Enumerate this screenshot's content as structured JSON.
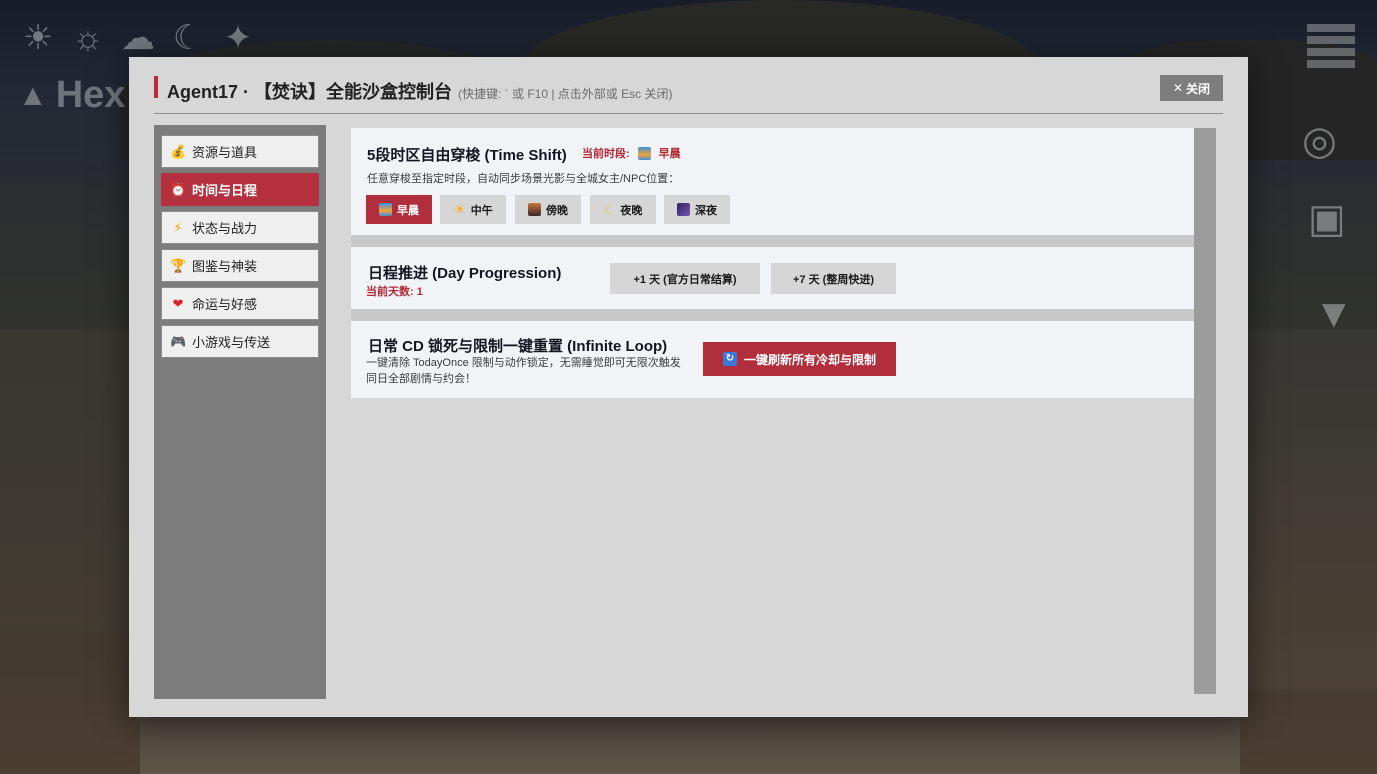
{
  "hud": {
    "title": "Hex",
    "left_icons": [
      "sunrise-icon",
      "sun-icon",
      "sunset-icon",
      "moon-icon",
      "star-icon"
    ]
  },
  "modal": {
    "title": "Agent17 · 【焚诀】全能沙盒控制台",
    "hint": "(快捷键: ` 或 F10 | 点击外部或 Esc 关闭)",
    "close_label": "关闭",
    "close_icon": "✕"
  },
  "sidebar": {
    "items": [
      {
        "label": "资源与道具",
        "icon": "💰",
        "icon_name": "money-bag-icon",
        "active": false
      },
      {
        "label": "时间与日程",
        "icon": "⏰",
        "icon_name": "alarm-clock-icon",
        "active": true
      },
      {
        "label": "状态与战力",
        "icon": "⚡",
        "icon_name": "lightning-icon",
        "active": false
      },
      {
        "label": "图鉴与神装",
        "icon": "🏆",
        "icon_name": "trophy-icon",
        "active": false
      },
      {
        "label": "命运与好感",
        "icon": "❤",
        "icon_name": "heart-icon",
        "active": false
      },
      {
        "label": "小游戏与传送",
        "icon": "🎮",
        "icon_name": "gamepad-icon",
        "active": false
      }
    ]
  },
  "time_shift": {
    "title": "5段时区自由穿梭 (Time Shift)",
    "current_label": "当前时段:",
    "current_value": "早晨",
    "description": "任意穿梭至指定时段，自动同步场景光影与全城女主/NPC位置：",
    "buttons": [
      {
        "label": "早晨",
        "icon_name": "sunrise-icon",
        "active": true,
        "icon_color": "#f0a43a"
      },
      {
        "label": "中午",
        "icon_name": "sun-icon",
        "active": false,
        "icon_color": "#f5b21c"
      },
      {
        "label": "傍晚",
        "icon_name": "city-dusk-icon",
        "active": false,
        "icon_color": "#6b4a3a"
      },
      {
        "label": "夜晚",
        "icon_name": "crescent-moon-icon",
        "active": false,
        "icon_color": "#e8c34a"
      },
      {
        "label": "深夜",
        "icon_name": "night-sky-icon",
        "active": false,
        "icon_color": "#5a3f8c"
      }
    ]
  },
  "day_progression": {
    "title": "日程推进 (Day Progression)",
    "days_label": "当前天数:",
    "days_value": "1",
    "buttons": [
      "+1 天 (官方日常结算)",
      "+7 天 (整周快进)"
    ]
  },
  "infinite_loop": {
    "title": "日常 CD 锁死与限制一键重置 (Infinite Loop)",
    "description": "一键清除 TodayOnce 限制与动作锁定，无需睡觉即可无限次触发同日全部剧情与约会！",
    "button_label": "一键刷新所有冷却与限制",
    "button_icon": "🔄"
  },
  "colors": {
    "accent": "#b12e3c",
    "panel": "#d7d7d7",
    "card": "#f2f3f7",
    "sidebar": "#7c7c7c"
  }
}
